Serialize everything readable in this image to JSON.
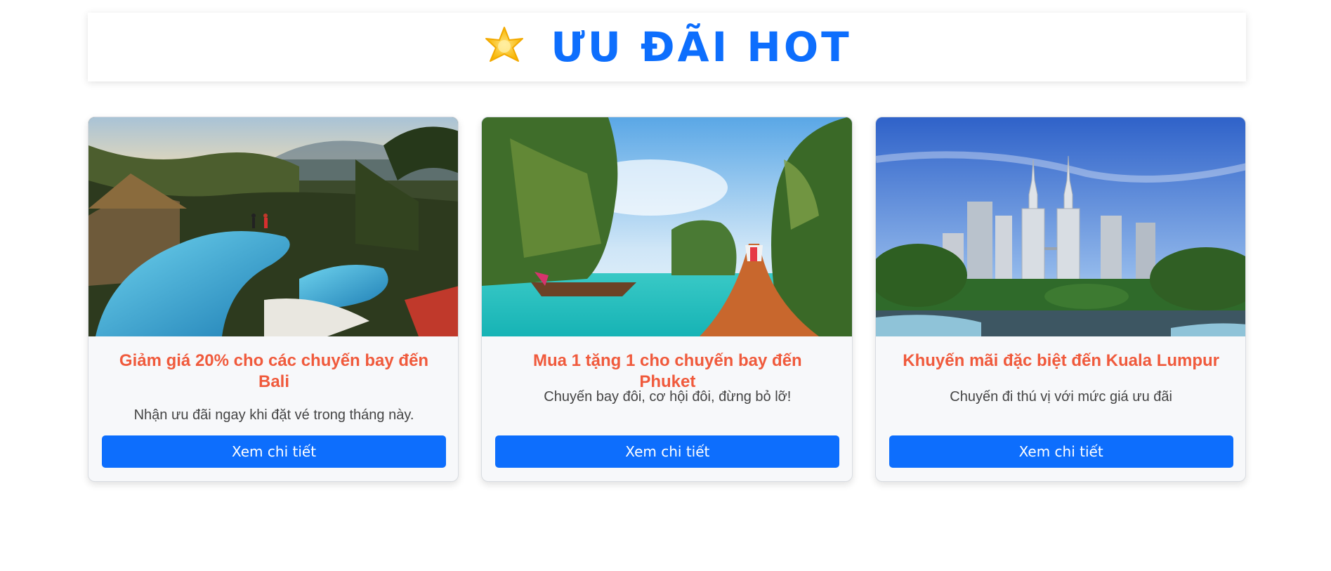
{
  "header": {
    "icon": "star-icon",
    "title": "ƯU ĐÃI HOT"
  },
  "colors": {
    "accent": "#0d6efd",
    "card_title": "#f05a3c",
    "card_bg": "#f7f8fa"
  },
  "cards": [
    {
      "image": "bali-resort-pool-image",
      "title": "Giảm giá 20% cho các chuyến bay đến Bali",
      "description": "Nhận ưu đãi ngay khi đặt vé trong tháng này.",
      "button_label": "Xem chi tiết"
    },
    {
      "image": "phuket-longtail-boat-image",
      "title": "Mua 1 tặng 1 cho chuyến bay đến Phuket",
      "description": "Chuyến bay đôi, cơ hội đôi, đừng bỏ lỡ!",
      "button_label": "Xem chi tiết"
    },
    {
      "image": "kuala-lumpur-petronas-towers-image",
      "title": "Khuyến mãi đặc biệt đến Kuala Lumpur",
      "description": "Chuyến đi thú vị với mức giá ưu đãi",
      "button_label": "Xem chi tiết"
    }
  ]
}
